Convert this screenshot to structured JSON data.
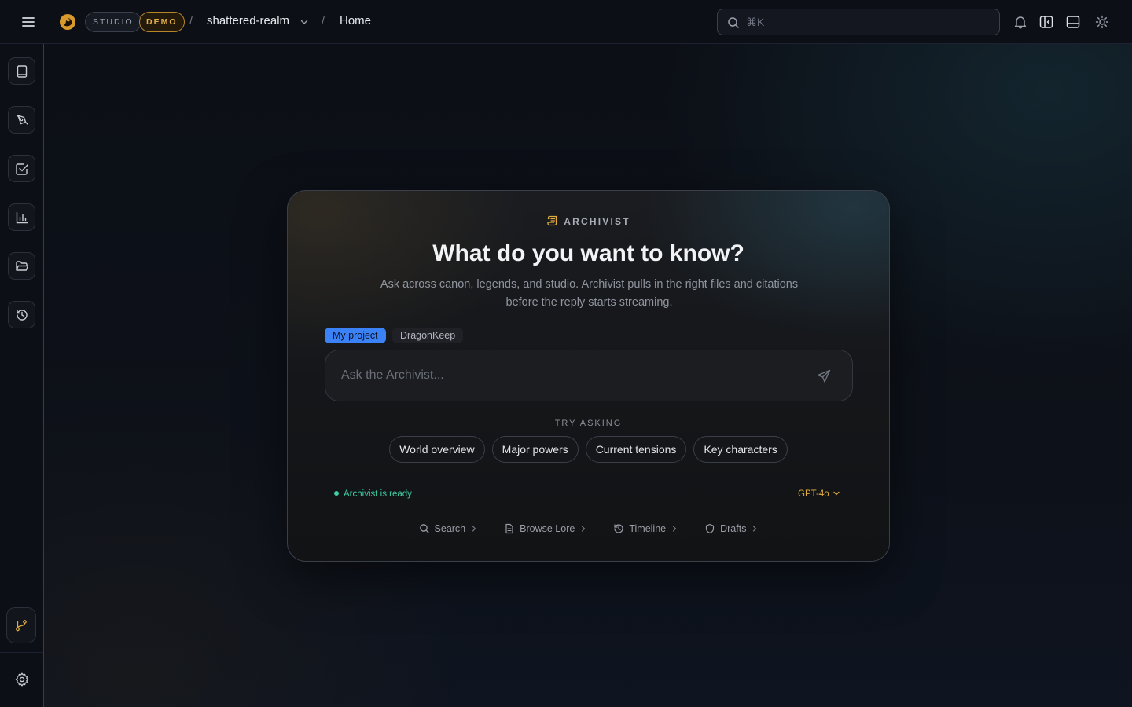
{
  "topbar": {
    "menu_icon": "hamburger-icon",
    "logo_icon": "dragon-logo-icon",
    "studio_badge": "STUDIO",
    "demo_badge": "DEMO",
    "separator": "/",
    "project": "shattered-realm",
    "page": "Home",
    "search_placeholder": "⌘K",
    "icons": [
      "bell-icon",
      "panel-left-icon",
      "panel-bottom-icon",
      "sun-icon"
    ]
  },
  "sidebar": {
    "items": [
      {
        "icon": "book-icon"
      },
      {
        "icon": "pen-tool-icon"
      },
      {
        "icon": "checkbox-icon"
      },
      {
        "icon": "bar-chart-icon"
      },
      {
        "icon": "folder-open-icon"
      },
      {
        "icon": "history-icon"
      }
    ],
    "bottom": [
      {
        "icon": "git-branch-icon"
      },
      {
        "icon": "gear-icon"
      }
    ]
  },
  "archivist": {
    "eyebrow": "ARCHIVIST",
    "title": "What do you want to know?",
    "subtitle": "Ask across canon, legends, and studio. Archivist pulls in the right files and citations before the reply starts streaming.",
    "scopes": [
      "My project",
      "DragonKeep"
    ],
    "active_scope": "My project",
    "input_placeholder": "Ask the Archivist...",
    "try_label": "TRY ASKING",
    "suggestions": [
      "World overview",
      "Major powers",
      "Current tensions",
      "Key characters"
    ],
    "status": "Archivist is ready",
    "model": "GPT-4o",
    "quick_links": [
      "Search",
      "Browse Lore",
      "Timeline",
      "Drafts"
    ],
    "colors": {
      "accent": "#3b82f6",
      "gold": "#e2ad3e",
      "ready": "#3ecfa5"
    }
  }
}
